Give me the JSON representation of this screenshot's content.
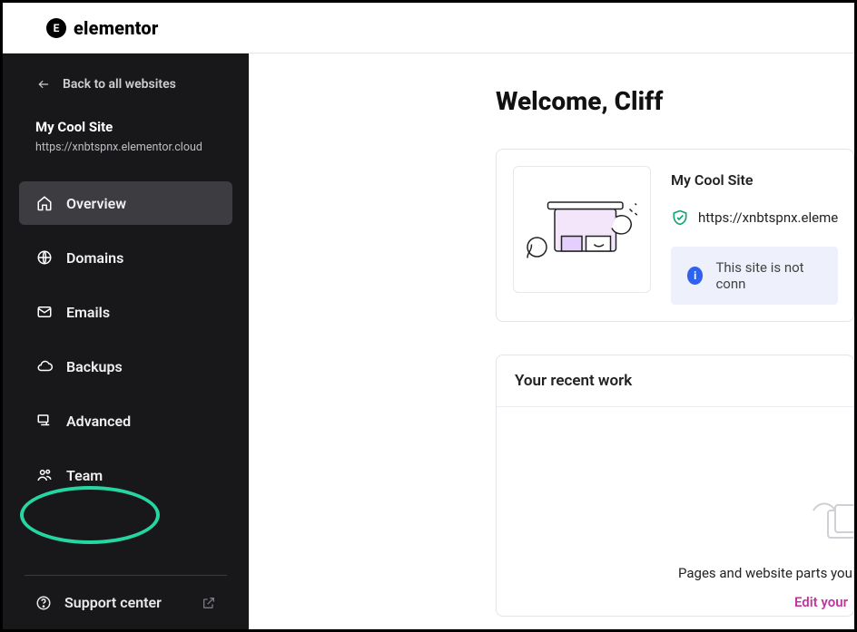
{
  "brand": {
    "name": "elementor",
    "mark": "E"
  },
  "sidebar": {
    "back_label": "Back to all websites",
    "site_name": "My Cool Site",
    "site_url": "https://xnbtspnx.elementor.cloud",
    "items": [
      {
        "label": "Overview"
      },
      {
        "label": "Domains"
      },
      {
        "label": "Emails"
      },
      {
        "label": "Backups"
      },
      {
        "label": "Advanced"
      },
      {
        "label": "Team"
      }
    ],
    "support_label": "Support center"
  },
  "main": {
    "welcome": "Welcome, Cliff",
    "site_card": {
      "title": "My Cool Site",
      "url_text": "https://xnbtspnx.eleme",
      "notice_text": "This site is not conn"
    },
    "recent": {
      "heading": "Your recent work",
      "caption": "Pages and website parts you",
      "edit_link": "Edit your"
    }
  }
}
